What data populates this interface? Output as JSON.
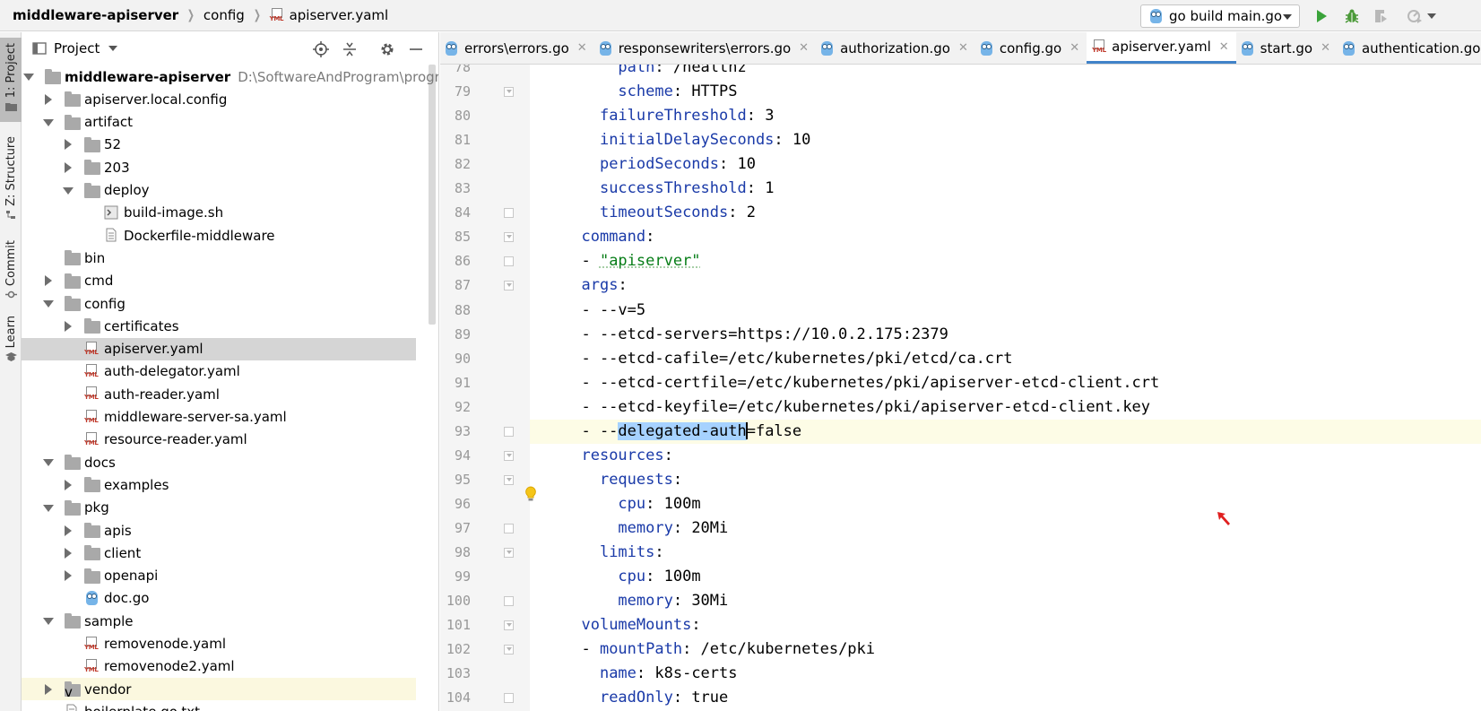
{
  "breadcrumb": {
    "project": "middleware-apiserver",
    "folder": "config",
    "file": "apiserver.yaml",
    "file_icon_text": "YML"
  },
  "toolbar": {
    "run_config": "go build main.go"
  },
  "tool_windows": [
    "1: Project",
    "Z: Structure",
    "Commit",
    "Learn"
  ],
  "project_panel": {
    "title": "Project",
    "tree": [
      {
        "label": "middleware-apiserver",
        "path": "D:\\SoftwareAndProgram\\program\\Go\\",
        "type": "folder",
        "depth": 0,
        "state": "open",
        "bold": true
      },
      {
        "label": "apiserver.local.config",
        "type": "folder",
        "depth": 1,
        "state": "closed"
      },
      {
        "label": "artifact",
        "type": "folder",
        "depth": 1,
        "state": "open"
      },
      {
        "label": "52",
        "type": "folder",
        "depth": 2,
        "state": "closed"
      },
      {
        "label": "203",
        "type": "folder",
        "depth": 2,
        "state": "closed"
      },
      {
        "label": "deploy",
        "type": "folder",
        "depth": 2,
        "state": "open"
      },
      {
        "label": "build-image.sh",
        "type": "shell",
        "depth": 3,
        "state": "none"
      },
      {
        "label": "Dockerfile-middleware",
        "type": "text",
        "depth": 3,
        "state": "none"
      },
      {
        "label": "bin",
        "type": "folder",
        "depth": 1,
        "state": "none"
      },
      {
        "label": "cmd",
        "type": "folder",
        "depth": 1,
        "state": "closed"
      },
      {
        "label": "config",
        "type": "folder",
        "depth": 1,
        "state": "open"
      },
      {
        "label": "certificates",
        "type": "folder",
        "depth": 2,
        "state": "closed"
      },
      {
        "label": "apiserver.yaml",
        "type": "yml",
        "depth": 2,
        "state": "none",
        "selected": true
      },
      {
        "label": "auth-delegator.yaml",
        "type": "yml",
        "depth": 2,
        "state": "none"
      },
      {
        "label": "auth-reader.yaml",
        "type": "yml",
        "depth": 2,
        "state": "none"
      },
      {
        "label": "middleware-server-sa.yaml",
        "type": "yml",
        "depth": 2,
        "state": "none"
      },
      {
        "label": "resource-reader.yaml",
        "type": "yml",
        "depth": 2,
        "state": "none"
      },
      {
        "label": "docs",
        "type": "folder",
        "depth": 1,
        "state": "open"
      },
      {
        "label": "examples",
        "type": "folder",
        "depth": 2,
        "state": "closed"
      },
      {
        "label": "pkg",
        "type": "folder",
        "depth": 1,
        "state": "open"
      },
      {
        "label": "apis",
        "type": "folder",
        "depth": 2,
        "state": "closed"
      },
      {
        "label": "client",
        "type": "folder",
        "depth": 2,
        "state": "closed"
      },
      {
        "label": "openapi",
        "type": "folder",
        "depth": 2,
        "state": "closed"
      },
      {
        "label": "doc.go",
        "type": "go",
        "depth": 2,
        "state": "none"
      },
      {
        "label": "sample",
        "type": "folder",
        "depth": 1,
        "state": "open"
      },
      {
        "label": "removenode.yaml",
        "type": "yml",
        "depth": 2,
        "state": "none"
      },
      {
        "label": "removenode2.yaml",
        "type": "yml",
        "depth": 2,
        "state": "none"
      },
      {
        "label": "vendor",
        "type": "vendor",
        "depth": 1,
        "state": "closed",
        "highlighted": true
      },
      {
        "label": "boilerplate.go.txt",
        "type": "text",
        "depth": 1,
        "state": "none"
      }
    ]
  },
  "tabs": [
    {
      "label": "errors\\errors.go",
      "icon": "go",
      "active": false
    },
    {
      "label": "responsewriters\\errors.go",
      "icon": "go",
      "active": false
    },
    {
      "label": "authorization.go",
      "icon": "go",
      "active": false
    },
    {
      "label": "config.go",
      "icon": "go",
      "active": false
    },
    {
      "label": "apiserver.yaml",
      "icon": "yml",
      "active": true
    },
    {
      "label": "start.go",
      "icon": "go",
      "active": false
    },
    {
      "label": "authentication.go",
      "icon": "go",
      "active": false
    }
  ],
  "editor": {
    "current_line": 93,
    "lines": [
      {
        "n": 78,
        "parts": [
          [
            "t",
            "      "
          ],
          [
            "k",
            "path"
          ],
          [
            "t",
            ": /healthz"
          ]
        ]
      },
      {
        "n": 79,
        "fold": "down",
        "parts": [
          [
            "t",
            "      "
          ],
          [
            "k",
            "scheme"
          ],
          [
            "t",
            ": HTTPS"
          ]
        ]
      },
      {
        "n": 80,
        "parts": [
          [
            "t",
            "    "
          ],
          [
            "k",
            "failureThreshold"
          ],
          [
            "t",
            ": 3"
          ]
        ]
      },
      {
        "n": 81,
        "parts": [
          [
            "t",
            "    "
          ],
          [
            "k",
            "initialDelaySeconds"
          ],
          [
            "t",
            ": 10"
          ]
        ]
      },
      {
        "n": 82,
        "parts": [
          [
            "t",
            "    "
          ],
          [
            "k",
            "periodSeconds"
          ],
          [
            "t",
            ": 10"
          ]
        ]
      },
      {
        "n": 83,
        "parts": [
          [
            "t",
            "    "
          ],
          [
            "k",
            "successThreshold"
          ],
          [
            "t",
            ": 1"
          ]
        ]
      },
      {
        "n": 84,
        "fold": "up",
        "parts": [
          [
            "t",
            "    "
          ],
          [
            "k",
            "timeoutSeconds"
          ],
          [
            "t",
            ": 2"
          ]
        ]
      },
      {
        "n": 85,
        "fold": "down",
        "parts": [
          [
            "t",
            "  "
          ],
          [
            "k",
            "command"
          ],
          [
            "t",
            ":"
          ]
        ]
      },
      {
        "n": 86,
        "fold": "up",
        "parts": [
          [
            "t",
            "  - "
          ],
          [
            "s",
            "\"apiserver\""
          ]
        ]
      },
      {
        "n": 87,
        "fold": "down",
        "parts": [
          [
            "t",
            "  "
          ],
          [
            "k",
            "args"
          ],
          [
            "t",
            ":"
          ]
        ]
      },
      {
        "n": 88,
        "parts": [
          [
            "t",
            "  - --v=5"
          ]
        ]
      },
      {
        "n": 89,
        "parts": [
          [
            "t",
            "  - --etcd-servers=https://10.0.2.175:2379"
          ]
        ]
      },
      {
        "n": 90,
        "parts": [
          [
            "t",
            "  - --etcd-cafile=/etc/kubernetes/pki/etcd/ca.crt"
          ]
        ]
      },
      {
        "n": 91,
        "parts": [
          [
            "t",
            "  - --etcd-certfile=/etc/kubernetes/pki/apiserver-etcd-client.crt"
          ]
        ]
      },
      {
        "n": 92,
        "parts": [
          [
            "t",
            "  - --etcd-keyfile=/etc/kubernetes/pki/apiserver-etcd-client.key"
          ]
        ]
      },
      {
        "n": 93,
        "fold": "up",
        "parts": [
          [
            "t",
            "  - --"
          ],
          [
            "sel",
            "delegated-auth"
          ],
          [
            "caret",
            ""
          ],
          [
            "t",
            "=false"
          ]
        ]
      },
      {
        "n": 94,
        "fold": "down",
        "parts": [
          [
            "t",
            "  "
          ],
          [
            "k",
            "resources"
          ],
          [
            "t",
            ":"
          ]
        ]
      },
      {
        "n": 95,
        "fold": "down",
        "parts": [
          [
            "t",
            "    "
          ],
          [
            "k",
            "requests"
          ],
          [
            "t",
            ":"
          ]
        ]
      },
      {
        "n": 96,
        "parts": [
          [
            "t",
            "      "
          ],
          [
            "k",
            "cpu"
          ],
          [
            "t",
            ": 100m"
          ]
        ]
      },
      {
        "n": 97,
        "fold": "up",
        "parts": [
          [
            "t",
            "      "
          ],
          [
            "k",
            "memory"
          ],
          [
            "t",
            ": 20Mi"
          ]
        ]
      },
      {
        "n": 98,
        "fold": "down",
        "parts": [
          [
            "t",
            "    "
          ],
          [
            "k",
            "limits"
          ],
          [
            "t",
            ":"
          ]
        ]
      },
      {
        "n": 99,
        "parts": [
          [
            "t",
            "      "
          ],
          [
            "k",
            "cpu"
          ],
          [
            "t",
            ": 100m"
          ]
        ]
      },
      {
        "n": 100,
        "fold": "up",
        "parts": [
          [
            "t",
            "      "
          ],
          [
            "k",
            "memory"
          ],
          [
            "t",
            ": 30Mi"
          ]
        ]
      },
      {
        "n": 101,
        "fold": "down",
        "parts": [
          [
            "t",
            "  "
          ],
          [
            "k",
            "volumeMounts"
          ],
          [
            "t",
            ":"
          ]
        ]
      },
      {
        "n": 102,
        "fold": "down",
        "parts": [
          [
            "t",
            "  - "
          ],
          [
            "k",
            "mountPath"
          ],
          [
            "t",
            ": /etc/kubernetes/pki"
          ]
        ]
      },
      {
        "n": 103,
        "parts": [
          [
            "t",
            "    "
          ],
          [
            "k",
            "name"
          ],
          [
            "t",
            ": k8s-certs"
          ]
        ]
      },
      {
        "n": 104,
        "fold": "up",
        "parts": [
          [
            "t",
            "    "
          ],
          [
            "k",
            "readOnly"
          ],
          [
            "t",
            ": true"
          ]
        ]
      }
    ]
  }
}
